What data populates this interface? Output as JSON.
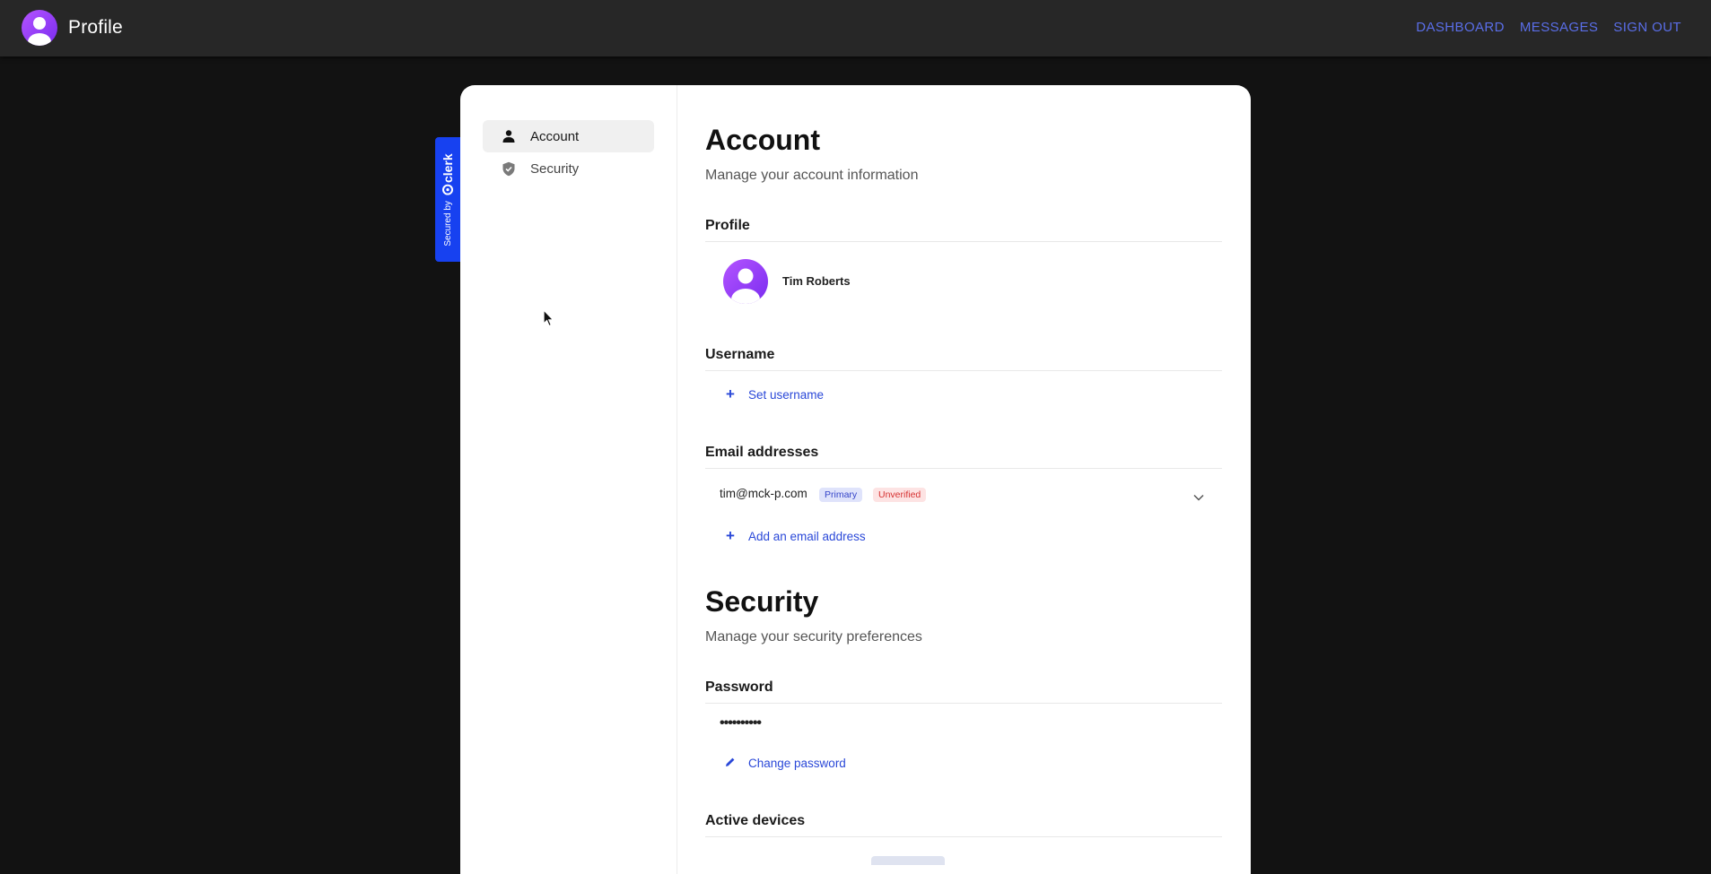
{
  "appbar": {
    "title": "Profile",
    "nav": [
      "DASHBOARD",
      "MESSAGES",
      "SIGN OUT"
    ]
  },
  "clerk_badge": {
    "secured_text": "Secured by",
    "brand_text": "clerk"
  },
  "sidebar": {
    "items": [
      {
        "label": "Account",
        "icon": "user-icon",
        "active": true
      },
      {
        "label": "Security",
        "icon": "shield-icon",
        "active": false
      }
    ]
  },
  "account": {
    "title": "Account",
    "subtitle": "Manage your account information",
    "profile_heading": "Profile",
    "user_name": "Tim Roberts",
    "username_heading": "Username",
    "set_username_label": "Set username",
    "email_heading": "Email addresses",
    "email": {
      "address": "tim@mck-p.com",
      "primary_badge": "Primary",
      "unverified_badge": "Unverified"
    },
    "add_email_label": "Add an email address"
  },
  "security": {
    "title": "Security",
    "subtitle": "Manage your security preferences",
    "password_heading": "Password",
    "password_mask": "••••••••••",
    "change_password_label": "Change password",
    "active_devices_heading": "Active devices"
  },
  "colors": {
    "background": "#121212",
    "appbar": "#272727",
    "nav_link": "#5a6ee8",
    "clerk_blue": "#1741f0",
    "action_link": "#2a48d8",
    "avatar_purple": "#9a40f7"
  }
}
